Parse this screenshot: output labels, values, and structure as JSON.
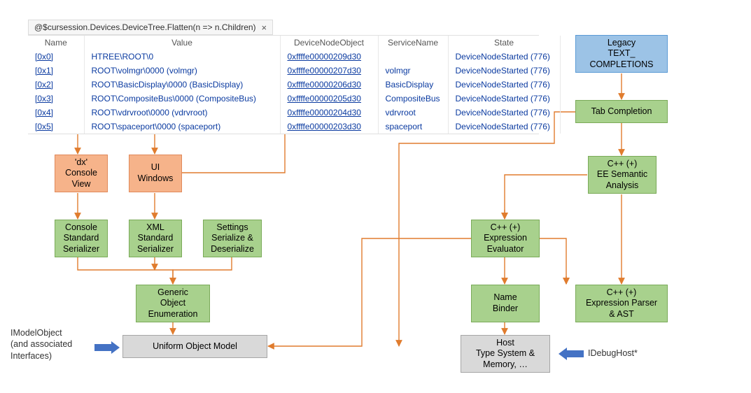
{
  "tab": {
    "title": "@$cursession.Devices.DeviceTree.Flatten(n => n.Children)",
    "close_glyph": "×"
  },
  "table": {
    "headers": [
      "Name",
      "Value",
      "DeviceNodeObject",
      "ServiceName",
      "State"
    ],
    "rows": [
      {
        "name": "[0x0]",
        "value": "HTREE\\ROOT\\0",
        "dno": "0xffffe00000209d30",
        "service": "",
        "state": "DeviceNodeStarted (776)"
      },
      {
        "name": "[0x1]",
        "value": "ROOT\\volmgr\\0000 (volmgr)",
        "dno": "0xffffe00000207d30",
        "service": "volmgr",
        "state": "DeviceNodeStarted (776)"
      },
      {
        "name": "[0x2]",
        "value": "ROOT\\BasicDisplay\\0000 (BasicDisplay)",
        "dno": "0xffffe00000206d30",
        "service": "BasicDisplay",
        "state": "DeviceNodeStarted (776)"
      },
      {
        "name": "[0x3]",
        "value": "ROOT\\CompositeBus\\0000 (CompositeBus)",
        "dno": "0xffffe00000205d30",
        "service": "CompositeBus",
        "state": "DeviceNodeStarted (776)"
      },
      {
        "name": "[0x4]",
        "value": "ROOT\\vdrvroot\\0000 (vdrvroot)",
        "dno": "0xffffe00000204d30",
        "service": "vdrvroot",
        "state": "DeviceNodeStarted (776)"
      },
      {
        "name": "[0x5]",
        "value": "ROOT\\spaceport\\0000 (spaceport)",
        "dno": "0xffffe00000203d30",
        "service": "spaceport",
        "state": "DeviceNodeStarted (776)"
      }
    ]
  },
  "nodes": {
    "dx": "'dx'\nConsole\nView",
    "uiwin": "UI\nWindows",
    "console_ser": "Console\nStandard\nSerializer",
    "xml_ser": "XML\nStandard\nSerializer",
    "settings_ser": "Settings\nSerialize &\nDeserialize",
    "generic_enum": "Generic\nObject\nEnumeration",
    "uom": "Uniform Object Model",
    "legacy": "Legacy\nTEXT_\nCOMPLETIONS",
    "tabcomp": "Tab Completion",
    "semantic": "C++ (+)\nEE Semantic\nAnalysis",
    "expreval": "C++ (+)\nExpression\nEvaluator",
    "namebinder": "Name\nBinder",
    "parser": "C++ (+)\nExpression Parser\n& AST",
    "host": "Host\nType System &\nMemory, …"
  },
  "labels": {
    "imodel": "IModelObject\n(and associated\nInterfaces)",
    "idebug": "IDebugHost*"
  },
  "colors": {
    "connector": "#e07c2e"
  }
}
